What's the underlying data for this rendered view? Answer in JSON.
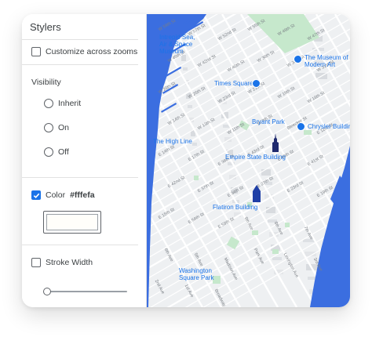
{
  "panel": {
    "title": "Stylers",
    "customize_label": "Customize across zooms",
    "visibility_label": "Visibility",
    "visibility_options": [
      "Inherit",
      "On",
      "Off"
    ],
    "color_label": "Color",
    "color_value": "#fffefa",
    "color_checked": true,
    "stroke_label": "Stroke Width",
    "stroke_checked": false,
    "stroke_level": 0
  },
  "map": {
    "water_color": "#3b6ee0",
    "park_color": "#c6e8cc",
    "accent_color": "#1a73e8",
    "pois": [
      "Intrepid Sea, Air & Space Museum",
      "The Museum of Modern Art",
      "Times Square",
      "Bryant Park",
      "Chrysler Building",
      "The High Line",
      "Empire State Building",
      "Flatiron Building",
      "Washington Square Park"
    ],
    "streets": [
      "W 59th St",
      "W 57th St",
      "W 52nd St",
      "W 55th St",
      "W 49th St",
      "W 47th St",
      "W 45th St",
      "W 42nd St",
      "W 40th St",
      "W 38th St",
      "W 34th St",
      "W 31st St",
      "W 28th St",
      "W 26th St",
      "W 23rd St",
      "W 21st St",
      "W 19th St",
      "W 18th St",
      "W 14th St",
      "W 13th St",
      "W 11th St",
      "W 8th St",
      "Bleecker St",
      "E 12th St",
      "E 14th St",
      "E 17th St",
      "E 36th St",
      "E 43rd St",
      "E 46th St",
      "E 41st St",
      "E 42nd St",
      "E 37th St",
      "E 34th St",
      "E 27th St",
      "E 23rd St",
      "E 19th St",
      "E 15th St",
      "E 56th St",
      "E 59th St",
      "9th Ave",
      "8th Ave",
      "7th Ave",
      "6th Ave",
      "5th Ave",
      "Madison Ave",
      "Park Ave",
      "Lexington Ave",
      "3rd Ave",
      "2nd Ave",
      "1st Ave",
      "Broadway"
    ]
  }
}
